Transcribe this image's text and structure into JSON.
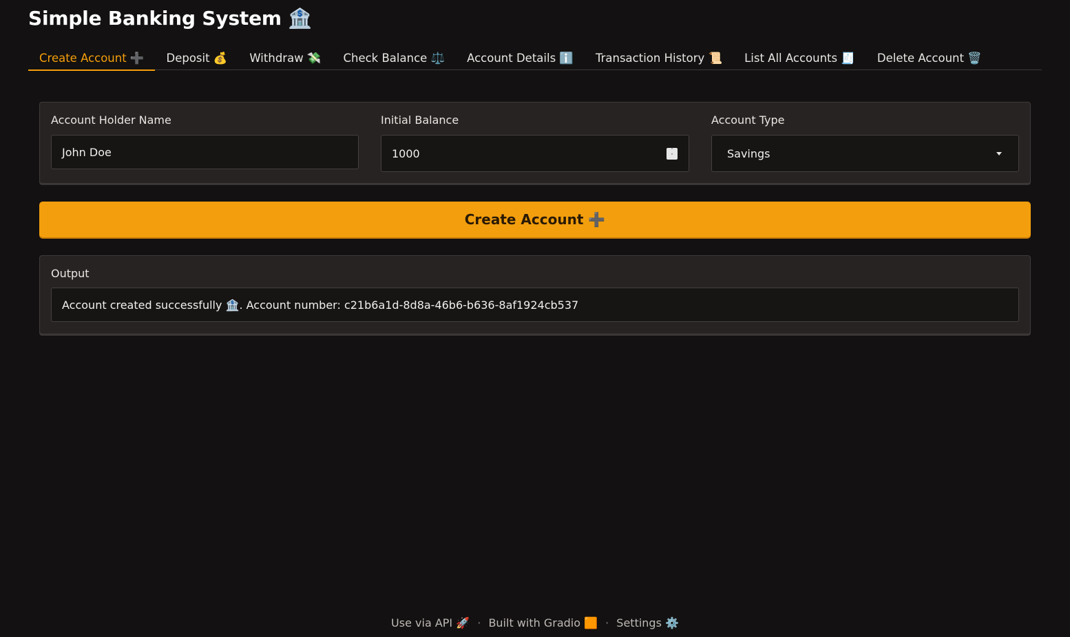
{
  "app": {
    "title": "Simple Banking System 🏦"
  },
  "tabs": [
    {
      "label": "Create Account ➕",
      "active": true
    },
    {
      "label": "Deposit 💰",
      "active": false
    },
    {
      "label": "Withdraw 💸",
      "active": false
    },
    {
      "label": "Check Balance ⚖️",
      "active": false
    },
    {
      "label": "Account Details ℹ️",
      "active": false
    },
    {
      "label": "Transaction History 📜",
      "active": false
    },
    {
      "label": "List All Accounts 🧾",
      "active": false
    },
    {
      "label": "Delete Account 🗑️",
      "active": false
    }
  ],
  "form": {
    "name": {
      "label": "Account Holder Name",
      "value": "John Doe"
    },
    "balance": {
      "label": "Initial Balance",
      "value": "1000"
    },
    "type": {
      "label": "Account Type",
      "value": "Savings"
    }
  },
  "button": {
    "label": "Create Account ➕"
  },
  "output": {
    "label": "Output",
    "value": "Account created successfully 🏦. Account number: c21b6a1d-8d8a-46b6-b636-8af1924cb537"
  },
  "footer": {
    "api": "Use via API 🚀",
    "gradio": "Built with Gradio 🟧",
    "settings": "Settings ⚙️",
    "separator": "·"
  },
  "colors": {
    "accent": "#f59e0b",
    "background": "#131111",
    "panel": "#272322"
  }
}
